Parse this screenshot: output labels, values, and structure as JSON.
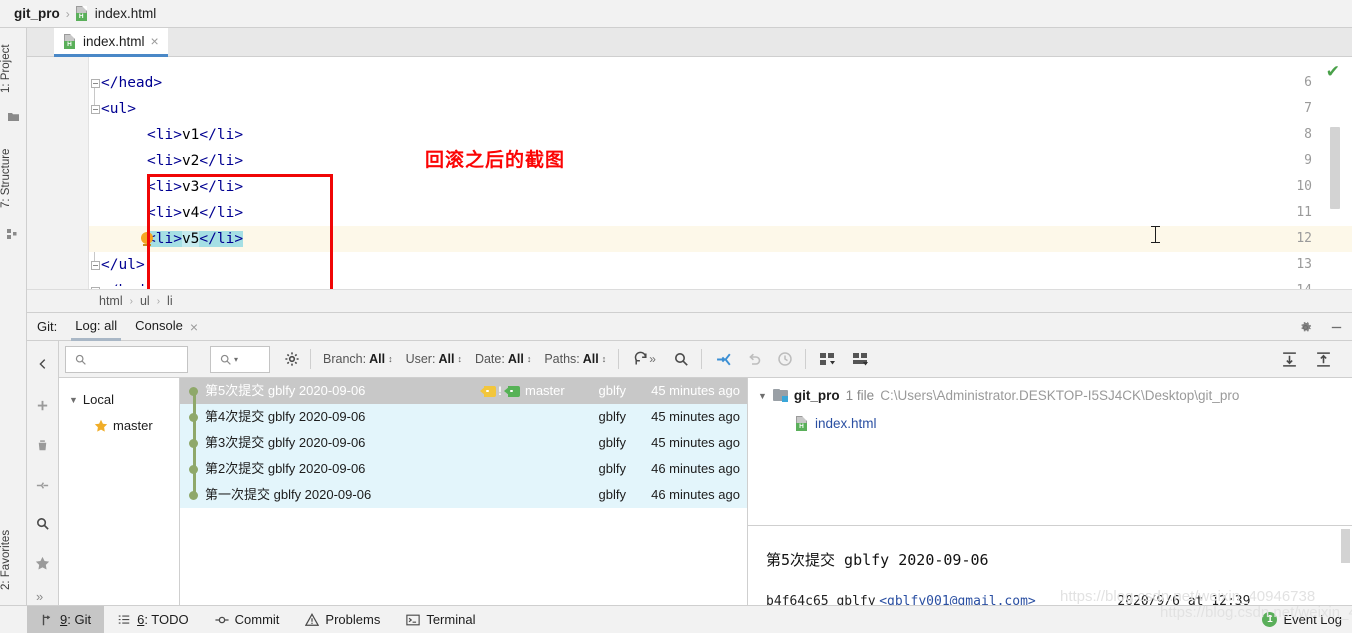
{
  "navbar": {
    "project": "git_pro",
    "separator": "›",
    "file": "index.html",
    "file_icon": "html-file-icon"
  },
  "editor_tabs": [
    {
      "label": "index.html",
      "icon": "html-file-icon",
      "close": "×",
      "active": true
    }
  ],
  "left_tool_strip": {
    "top_tabs": [
      {
        "label": "1: Project",
        "icon": "project-folder-icon"
      },
      {
        "label": "7: Structure",
        "icon": "structure-icon"
      }
    ],
    "bottom_tabs": [
      {
        "label": "2: Favorites",
        "icon": "star-icon"
      }
    ]
  },
  "editor": {
    "annotation": "回滚之后的截图",
    "lines": [
      {
        "num": "6",
        "indent": 0,
        "segments": [
          {
            "t": "</",
            "c": "punct"
          },
          {
            "t": "head",
            "c": "tagname"
          },
          {
            "t": ">",
            "c": "punct"
          }
        ],
        "fold": true
      },
      {
        "num": "7",
        "indent": 0,
        "segments": [
          {
            "t": "<",
            "c": "punct"
          },
          {
            "t": "ul",
            "c": "tagname"
          },
          {
            "t": ">",
            "c": "punct"
          }
        ],
        "fold": true
      },
      {
        "num": "8",
        "indent": 1,
        "segments": [
          {
            "t": "<",
            "c": "punct"
          },
          {
            "t": "li",
            "c": "tagname"
          },
          {
            "t": ">",
            "c": "punct"
          },
          {
            "t": "v1",
            "c": "txt"
          },
          {
            "t": "</",
            "c": "punct"
          },
          {
            "t": "li",
            "c": "tagname"
          },
          {
            "t": ">",
            "c": "punct"
          }
        ]
      },
      {
        "num": "9",
        "indent": 1,
        "segments": [
          {
            "t": "<",
            "c": "punct"
          },
          {
            "t": "li",
            "c": "tagname"
          },
          {
            "t": ">",
            "c": "punct"
          },
          {
            "t": "v2",
            "c": "txt"
          },
          {
            "t": "</",
            "c": "punct"
          },
          {
            "t": "li",
            "c": "tagname"
          },
          {
            "t": ">",
            "c": "punct"
          }
        ]
      },
      {
        "num": "10",
        "indent": 1,
        "segments": [
          {
            "t": "<",
            "c": "punct"
          },
          {
            "t": "li",
            "c": "tagname"
          },
          {
            "t": ">",
            "c": "punct"
          },
          {
            "t": "v3",
            "c": "txt"
          },
          {
            "t": "</",
            "c": "punct"
          },
          {
            "t": "li",
            "c": "tagname"
          },
          {
            "t": ">",
            "c": "punct"
          }
        ]
      },
      {
        "num": "11",
        "indent": 1,
        "segments": [
          {
            "t": "<",
            "c": "punct"
          },
          {
            "t": "li",
            "c": "tagname"
          },
          {
            "t": ">",
            "c": "punct"
          },
          {
            "t": "v4",
            "c": "txt"
          },
          {
            "t": "</",
            "c": "punct"
          },
          {
            "t": "li",
            "c": "tagname"
          },
          {
            "t": ">",
            "c": "punct"
          }
        ]
      },
      {
        "num": "12",
        "indent": 1,
        "current": true,
        "bulb": true,
        "segments": [
          {
            "t": "<",
            "c": "punct sel"
          },
          {
            "t": "li",
            "c": "tagname sel"
          },
          {
            "t": ">",
            "c": "punct sel"
          },
          {
            "t": "v5",
            "c": "txt sel2"
          },
          {
            "t": "</",
            "c": "punct sel"
          },
          {
            "t": "li",
            "c": "tagname sel"
          },
          {
            "t": ">",
            "c": "punct sel"
          }
        ]
      },
      {
        "num": "13",
        "indent": 0,
        "segments": [
          {
            "t": "</",
            "c": "punct"
          },
          {
            "t": "ul",
            "c": "tagname"
          },
          {
            "t": ">",
            "c": "punct"
          }
        ],
        "fold": true
      },
      {
        "num": "14",
        "indent": 0,
        "segments": [
          {
            "t": "</body>",
            "c": "punct"
          }
        ],
        "clipped": true,
        "fold": true
      }
    ],
    "inspection_status": "✔"
  },
  "breadcrumbs": {
    "items": [
      "html",
      "ul",
      "li"
    ],
    "separator": "›"
  },
  "git_panel": {
    "title": "Git:",
    "tabs": [
      {
        "label": "Log: all",
        "active": true,
        "closable": false
      },
      {
        "label": "Console",
        "active": false,
        "closable": true,
        "close": "×"
      }
    ],
    "header_actions": [
      {
        "name": "settings-gear-icon"
      },
      {
        "name": "minimize-icon"
      }
    ],
    "toolbar": {
      "collapse_label": "‹",
      "search_placeholder": "",
      "filters": [
        {
          "label": "Branch:",
          "value": "All"
        },
        {
          "label": "User:",
          "value": "All"
        },
        {
          "label": "Date:",
          "value": "All"
        },
        {
          "label": "Paths:",
          "value": "All"
        }
      ],
      "actions": [
        "refresh-icon",
        "expand-more-icon",
        "search-icon",
        "collapse-all-icon",
        "undo-icon",
        "history-clock-icon",
        "show-diff-layout-icon",
        "preview-layout-icon",
        "expand-all-right-icon",
        "collapse-all-right-icon"
      ]
    },
    "side_actions": [
      "add-icon",
      "delete-icon",
      "collapse-icon",
      "search-icon",
      "favorite-star-icon",
      "more-icon"
    ],
    "branches": {
      "root": "Local",
      "items": [
        {
          "label": "master",
          "favorite": true
        }
      ]
    },
    "commits": [
      {
        "subject": "第5次提交 gblfy 2020-09-06",
        "refs": [
          {
            "type": "tag",
            "color": "#f2c63c"
          },
          {
            "type": "excl"
          },
          {
            "type": "branch",
            "color": "#56b256",
            "label": "master"
          }
        ],
        "author": "gblfy",
        "date": "45 minutes ago",
        "selected": true
      },
      {
        "subject": "第4次提交 gblfy 2020-09-06",
        "refs": [],
        "author": "gblfy",
        "date": "45 minutes ago",
        "selected": false
      },
      {
        "subject": "第3次提交 gblfy 2020-09-06",
        "refs": [],
        "author": "gblfy",
        "date": "45 minutes ago",
        "selected": false
      },
      {
        "subject": "第2次提交 gblfy 2020-09-06",
        "refs": [],
        "author": "gblfy",
        "date": "46 minutes ago",
        "selected": false
      },
      {
        "subject": "第一次提交 gblfy 2020-09-06",
        "refs": [],
        "author": "gblfy",
        "date": "46 minutes ago",
        "selected": false
      }
    ],
    "changed_files": {
      "root": {
        "name": "git_pro",
        "count": "1 file",
        "path": "C:\\Users\\Administrator.DESKTOP-I5SJ4CK\\Desktop\\git_pro"
      },
      "files": [
        {
          "name": "index.html",
          "icon": "html-file-icon"
        }
      ]
    },
    "commit_detail": {
      "message": "第5次提交 gblfy 2020-09-06"
    }
  },
  "statusbar": {
    "items": [
      {
        "label": "9: Git",
        "underline": "9",
        "icon": "git-branch-icon",
        "active": true
      },
      {
        "label": "6: TODO",
        "underline": "6",
        "icon": "todo-list-icon",
        "active": false
      },
      {
        "label": "Commit",
        "icon": "commit-icon",
        "active": false
      },
      {
        "label": "Problems",
        "icon": "warning-triangle-icon",
        "active": false
      },
      {
        "label": "Terminal",
        "icon": "terminal-icon",
        "active": false
      }
    ],
    "event_log": {
      "label": "Event Log",
      "badge": "1"
    }
  },
  "watermark": "https://blog.csdn.net/weixin_40946738"
}
